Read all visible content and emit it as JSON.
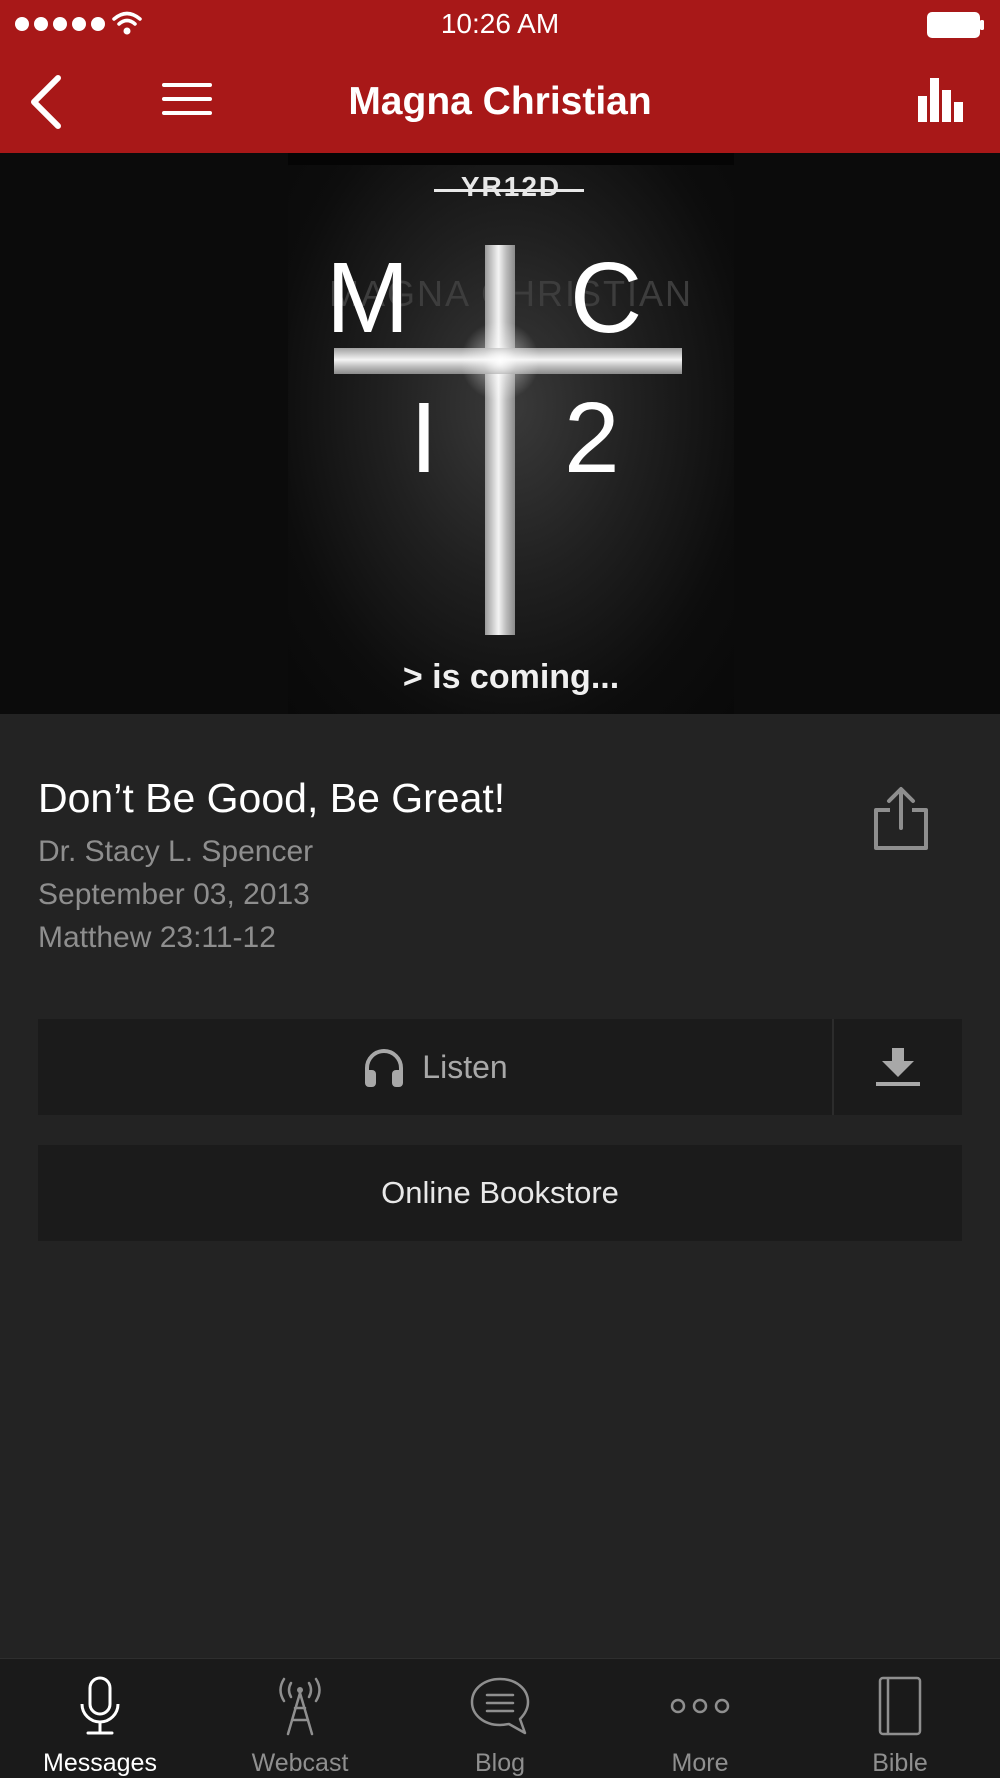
{
  "status_bar": {
    "time": "10:26 AM"
  },
  "nav": {
    "title": "Magna Christian"
  },
  "banner": {
    "top_text": "YR12D",
    "ghost_text": "MAGNA CHRISTIAN",
    "letters": [
      "M",
      "C",
      "I",
      "2"
    ],
    "bottom_text": "> is coming..."
  },
  "sermon": {
    "title": "Don’t Be Good, Be Great!",
    "speaker": "Dr. Stacy L. Spencer",
    "date": "September 03, 2013",
    "scripture": "Matthew 23:11-12"
  },
  "actions": {
    "listen_label": "Listen",
    "bookstore_label": "Online Bookstore"
  },
  "tabs": [
    {
      "label": "Messages",
      "icon": "microphone-icon",
      "active": true
    },
    {
      "label": "Webcast",
      "icon": "antenna-icon",
      "active": false
    },
    {
      "label": "Blog",
      "icon": "chat-bubble-icon",
      "active": false
    },
    {
      "label": "More",
      "icon": "more-dots-icon",
      "active": false
    },
    {
      "label": "Bible",
      "icon": "book-icon",
      "active": false
    }
  ],
  "colors": {
    "header": "#a81818",
    "background": "#232323",
    "button": "#1b1b1b",
    "tab_bar": "#1a1a1a"
  }
}
